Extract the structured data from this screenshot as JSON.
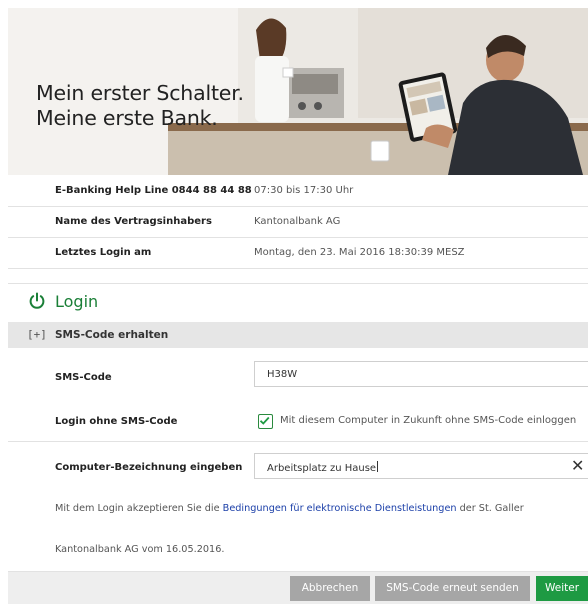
{
  "hero": {
    "line1": "Mein erster Schalter.",
    "line2": "Meine erste Bank."
  },
  "info": [
    {
      "label": "E-Banking Help Line 0844 88 44 88",
      "value": "07:30 bis 17:30 Uhr"
    },
    {
      "label": "Name des Vertragsinhabers",
      "value": "Kantonalbank AG"
    },
    {
      "label": "Letztes Login am",
      "value": "Montag, den 23. Mai 2016 18:30:39 MESZ"
    }
  ],
  "login": {
    "title": "Login",
    "icon": "power-icon",
    "sms_section": {
      "toggle": "[+]",
      "label": "SMS-Code erhalten"
    },
    "sms_code": {
      "label": "SMS-Code",
      "value": "H38W"
    },
    "no_sms": {
      "label": "Login ohne SMS-Code",
      "checkbox_label": "Mit diesem Computer in Zukunft ohne SMS-Code einloggen",
      "checked": true
    },
    "computer_name": {
      "label": "Computer-Bezeichnung eingeben",
      "value": "Arbeitsplatz zu Hause",
      "clear": "✕"
    },
    "terms": {
      "before": "Mit dem Login akzeptieren Sie die ",
      "link": "Bedingungen für elektronische Dienstleistungen",
      "after": " der St. Galler",
      "line2": "Kantonalbank AG vom 16.05.2016."
    }
  },
  "buttons": {
    "cancel": "Abbrechen",
    "resend": "SMS-Code erneut senden",
    "next": "Weiter"
  },
  "colors": {
    "accent": "#1e9a43",
    "link": "#1b3fa8",
    "button_grey": "#a6a6a6"
  }
}
